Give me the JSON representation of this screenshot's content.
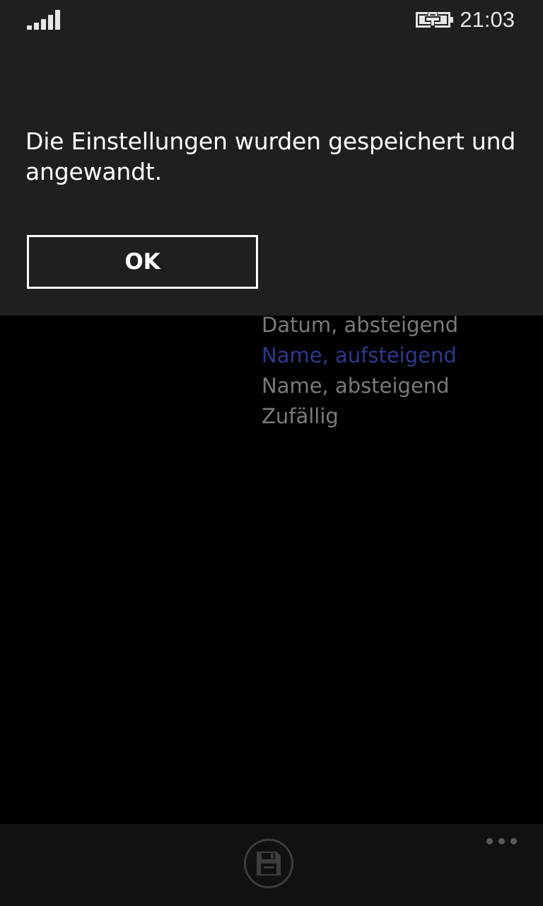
{
  "status_bar": {
    "time": "21:03",
    "signal_icon": "signal-strength-icon",
    "battery_icon": "battery-charging-icon"
  },
  "dialog": {
    "message": "Die Einstellungen wurden gespeichert und angewandt.",
    "ok_label": "OK"
  },
  "sort_options": {
    "items": [
      {
        "label": "Datum, absteigend",
        "selected": false
      },
      {
        "label": "Name, aufsteigend",
        "selected": true
      },
      {
        "label": "Name, absteigend",
        "selected": false
      },
      {
        "label": "Zufällig",
        "selected": false
      }
    ]
  },
  "app_bar": {
    "save_icon": "save-icon",
    "more_icon": "more-ellipsis-icon"
  },
  "colors": {
    "dialog_background": "#1f1f1f",
    "page_background": "#000000",
    "accent_selected": "#2b3a8f",
    "app_bar_background": "#111111"
  }
}
